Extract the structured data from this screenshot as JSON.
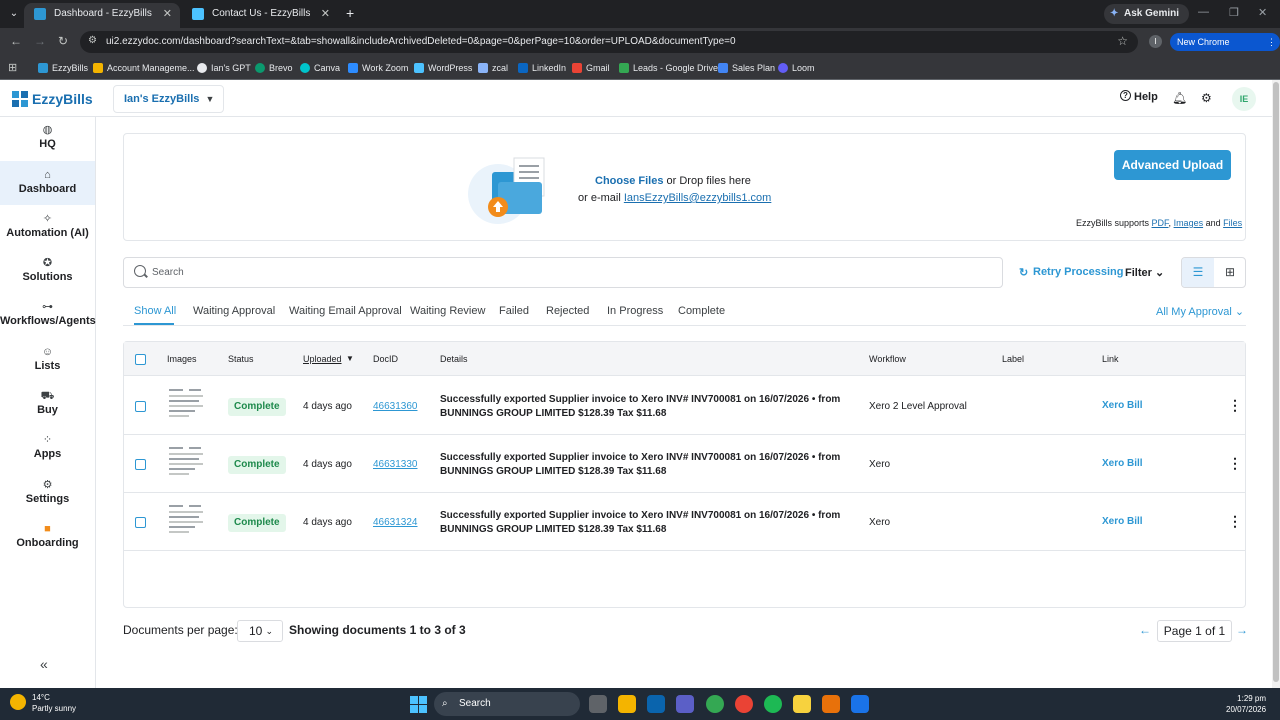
{
  "browser": {
    "tabs": [
      {
        "title": "Dashboard - EzzyBills",
        "active": true
      },
      {
        "title": "Contact Us - EzzyBills",
        "active": false
      }
    ],
    "gemini": "Ask Gemini",
    "url": "ui2.ezzydoc.com/dashboard?searchText=&tab=showall&includeArchivedDeleted=0&page=0&perPage=10&order=UPLOAD&documentType=0",
    "profile_initial": "I",
    "new_chrome": "New Chrome available",
    "bookmarks": [
      "EzzyBills",
      "Account Manageme...",
      "Ian's GPT",
      "Brevo",
      "Canva",
      "Work Zoom",
      "WordPress",
      "zcal",
      "LinkedIn",
      "Gmail",
      "Leads - Google Drive",
      "Sales Plan",
      "Loom"
    ]
  },
  "app": {
    "logo": "EzzyBills",
    "workspace": "Ian's EzzyBills",
    "header": {
      "help": "Help",
      "avatar": "IE"
    },
    "sidebar": [
      {
        "label": "HQ",
        "icon": "globe-icon"
      },
      {
        "label": "Dashboard",
        "icon": "home-icon"
      },
      {
        "label": "Automation (AI)",
        "icon": "sparkle-icon"
      },
      {
        "label": "Solutions",
        "icon": "bulb-icon"
      },
      {
        "label": "Workflows/Agents",
        "icon": "workflow-icon"
      },
      {
        "label": "Lists",
        "icon": "users-icon"
      },
      {
        "label": "Buy",
        "icon": "cart-icon"
      },
      {
        "label": "Apps",
        "icon": "apps-icon"
      },
      {
        "label": "Settings",
        "icon": "gear-icon"
      },
      {
        "label": "Onboarding",
        "icon": "video-icon"
      }
    ],
    "upload": {
      "choose": "Choose Files",
      "drop": " or Drop files here",
      "email_prefix": "or e-mail ",
      "email": "IansEzzyBills@ezzybills1.com",
      "advanced": "Advanced Upload",
      "supports_prefix": "EzzyBills supports ",
      "pdf": "PDF",
      "images": "Images",
      "and": " and ",
      "files": "Files"
    },
    "search_placeholder": "Search",
    "retry": "Retry Processing",
    "filter": "Filter",
    "filter_tabs": [
      "Show All",
      "Waiting Approval",
      "Waiting Email Approval",
      "Waiting Review",
      "Failed",
      "Rejected",
      "In Progress",
      "Complete"
    ],
    "approval_filter": "All My Approval",
    "columns": [
      "Images",
      "Status",
      "Uploaded",
      "DocID",
      "Details",
      "Workflow",
      "Label",
      "Link"
    ],
    "rows": [
      {
        "status": "Complete",
        "uploaded": "4 days ago",
        "docid": "46631360",
        "details": "Successfully exported Supplier invoice to Xero INV# INV700081 on 16/07/2026 • from BUNNINGS GROUP LIMITED $128.39 Tax $11.68",
        "workflow": "Xero 2 Level Approval",
        "label": "",
        "link": "Xero Bill"
      },
      {
        "status": "Complete",
        "uploaded": "4 days ago",
        "docid": "46631330",
        "details": "Successfully exported Supplier invoice to Xero INV# INV700081 on 16/07/2026 • from BUNNINGS GROUP LIMITED $128.39 Tax $11.68",
        "workflow": "Xero",
        "label": "",
        "link": "Xero Bill"
      },
      {
        "status": "Complete",
        "uploaded": "4 days ago",
        "docid": "46631324",
        "details": "Successfully exported Supplier invoice to Xero INV# INV700081 on 16/07/2026 • from BUNNINGS GROUP LIMITED $128.39 Tax $11.68",
        "workflow": "Xero",
        "label": "",
        "link": "Xero Bill"
      }
    ],
    "pagination": {
      "per_page_label": "Documents per page:",
      "per_page": "10",
      "showing": "Showing documents 1 to 3 of 3",
      "page": "Page 1 of 1"
    }
  },
  "taskbar": {
    "weather_temp": "14°C",
    "weather_desc": "Partly sunny",
    "search": "Search",
    "time": "1:29 pm",
    "date": "20/07/2026"
  }
}
